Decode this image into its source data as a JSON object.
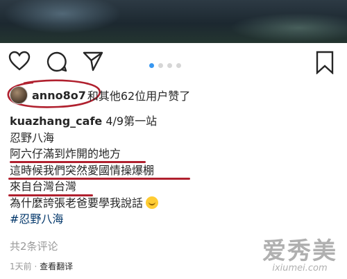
{
  "post": {
    "likes": {
      "username": "anno8o7",
      "rest": "和其他62位用户赞了"
    },
    "caption": {
      "author": "kuazhang_cafe",
      "first_line_text": "4/9第一站",
      "lines": [
        "忍野八海",
        "阿六仔滿到炸開的地方",
        "這時候我們突然愛國情操爆棚",
        "來自台灣台灣",
        "為什麼誇張老爸要學我說話"
      ],
      "hashtag": "#忍野八海"
    },
    "comments_label": "共2条评论",
    "time": "1天前",
    "separator": "·",
    "translate": "查看翻译"
  },
  "carousel": {
    "count": 4,
    "active_index": 0
  },
  "icons": [
    "heart-icon",
    "comment-icon",
    "share-icon",
    "bookmark-icon",
    "laughing-emoji-icon"
  ],
  "colors": {
    "accent": "#3897f0",
    "annotation": "#b0202e",
    "hashtag": "#003569"
  },
  "watermark": {
    "cn": "爱秀美",
    "url": "ixiumei.com"
  }
}
